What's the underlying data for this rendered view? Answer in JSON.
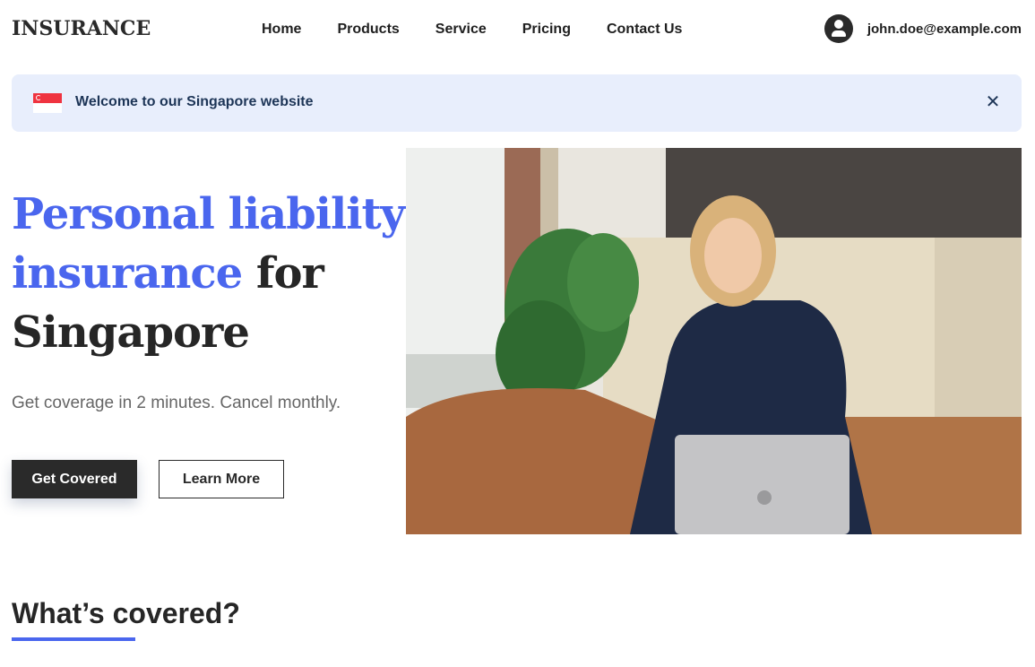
{
  "header": {
    "logo": "INSURANCE",
    "nav": [
      "Home",
      "Products",
      "Service",
      "Pricing",
      "Contact Us"
    ],
    "user_email": "john.doe@example.com",
    "user_icon": "account-circle-icon"
  },
  "banner": {
    "flag_icon": "singapore-flag-icon",
    "text": "Welcome to our Singapore website",
    "close_icon": "close-icon",
    "close_glyph": "✕"
  },
  "hero": {
    "title_accent": "Personal liability insurance",
    "title_rest": " for Singapore",
    "subtitle": "Get coverage in 2 minutes. Cancel monthly.",
    "primary_button": "Get Covered",
    "secondary_button": "Learn More",
    "image_alt": "Smiling woman on phone sitting on leather couch with laptop"
  },
  "section": {
    "title": "What’s covered?"
  },
  "colors": {
    "accent": "#4a66ee",
    "banner_bg": "#e8eefc",
    "dark": "#2a2a2a"
  }
}
